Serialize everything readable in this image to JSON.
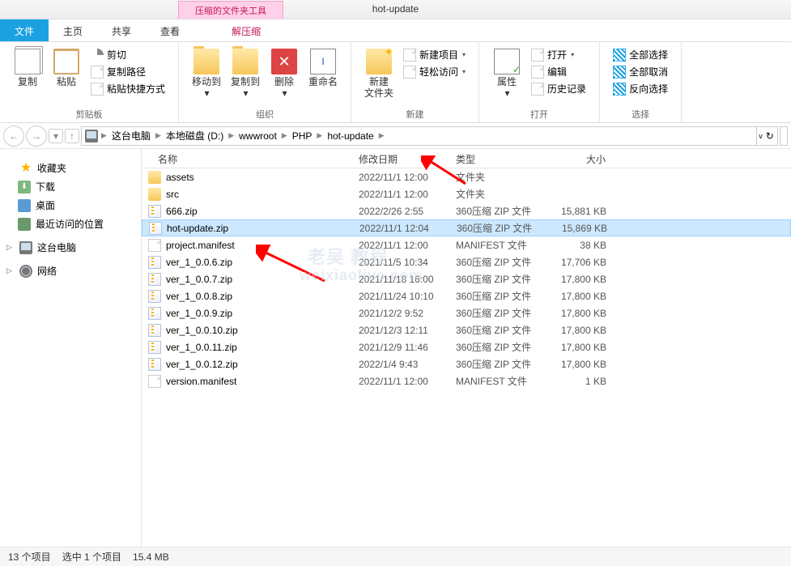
{
  "window": {
    "title": "hot-update",
    "context_tab": "压缩的文件夹工具"
  },
  "tabs": {
    "file": "文件",
    "home": "主页",
    "share": "共享",
    "view": "查看",
    "extract": "解压缩"
  },
  "ribbon": {
    "clipboard": {
      "label": "剪贴板",
      "copy": "复制",
      "paste": "粘贴",
      "cut": "剪切",
      "copy_path": "复制路径",
      "paste_shortcut": "粘贴快捷方式"
    },
    "organize": {
      "label": "组织",
      "move_to": "移动到",
      "copy_to": "复制到",
      "delete": "删除",
      "rename": "重命名"
    },
    "new": {
      "label": "新建",
      "new_folder": "新建\n文件夹",
      "new_item": "新建项目",
      "easy_access": "轻松访问"
    },
    "open": {
      "label": "打开",
      "properties": "属性",
      "open_btn": "打开",
      "edit": "编辑",
      "history": "历史记录"
    },
    "select": {
      "label": "选择",
      "select_all": "全部选择",
      "select_none": "全部取消",
      "invert": "反向选择"
    }
  },
  "breadcrumb": [
    "这台电脑",
    "本地磁盘 (D:)",
    "wwwroot",
    "PHP",
    "hot-update"
  ],
  "columns": {
    "name": "名称",
    "date": "修改日期",
    "type": "类型",
    "size": "大小"
  },
  "nav": {
    "favorites": "收藏夹",
    "downloads": "下载",
    "desktop": "桌面",
    "recent": "最近访问的位置",
    "this_pc": "这台电脑",
    "network": "网络"
  },
  "files": [
    {
      "icon": "folder",
      "name": "assets",
      "date": "2022/11/1 12:00",
      "type": "文件夹",
      "size": ""
    },
    {
      "icon": "folder",
      "name": "src",
      "date": "2022/11/1 12:00",
      "type": "文件夹",
      "size": ""
    },
    {
      "icon": "zip",
      "name": "666.zip",
      "date": "2022/2/26 2:55",
      "type": "360压缩 ZIP 文件",
      "size": "15,881 KB"
    },
    {
      "icon": "zip",
      "name": "hot-update.zip",
      "date": "2022/11/1 12:04",
      "type": "360压缩 ZIP 文件",
      "size": "15,869 KB",
      "selected": true
    },
    {
      "icon": "file",
      "name": "project.manifest",
      "date": "2022/11/1 12:00",
      "type": "MANIFEST 文件",
      "size": "38 KB"
    },
    {
      "icon": "zip",
      "name": "ver_1_0.0.6.zip",
      "date": "2021/11/5 10:34",
      "type": "360压缩 ZIP 文件",
      "size": "17,706 KB"
    },
    {
      "icon": "zip",
      "name": "ver_1_0.0.7.zip",
      "date": "2021/11/18 16:00",
      "type": "360压缩 ZIP 文件",
      "size": "17,800 KB"
    },
    {
      "icon": "zip",
      "name": "ver_1_0.0.8.zip",
      "date": "2021/11/24 10:10",
      "type": "360压缩 ZIP 文件",
      "size": "17,800 KB"
    },
    {
      "icon": "zip",
      "name": "ver_1_0.0.9.zip",
      "date": "2021/12/2 9:52",
      "type": "360压缩 ZIP 文件",
      "size": "17,800 KB"
    },
    {
      "icon": "zip",
      "name": "ver_1_0.0.10.zip",
      "date": "2021/12/3 12:11",
      "type": "360压缩 ZIP 文件",
      "size": "17,800 KB"
    },
    {
      "icon": "zip",
      "name": "ver_1_0.0.11.zip",
      "date": "2021/12/9 11:46",
      "type": "360压缩 ZIP 文件",
      "size": "17,800 KB"
    },
    {
      "icon": "zip",
      "name": "ver_1_0.0.12.zip",
      "date": "2022/1/4 9:43",
      "type": "360压缩 ZIP 文件",
      "size": "17,800 KB"
    },
    {
      "icon": "file",
      "name": "version.manifest",
      "date": "2022/11/1 12:00",
      "type": "MANIFEST 文件",
      "size": "1 KB"
    }
  ],
  "status": {
    "count": "13 个项目",
    "selection": "选中 1 个项目",
    "size": "15.4 MB"
  }
}
